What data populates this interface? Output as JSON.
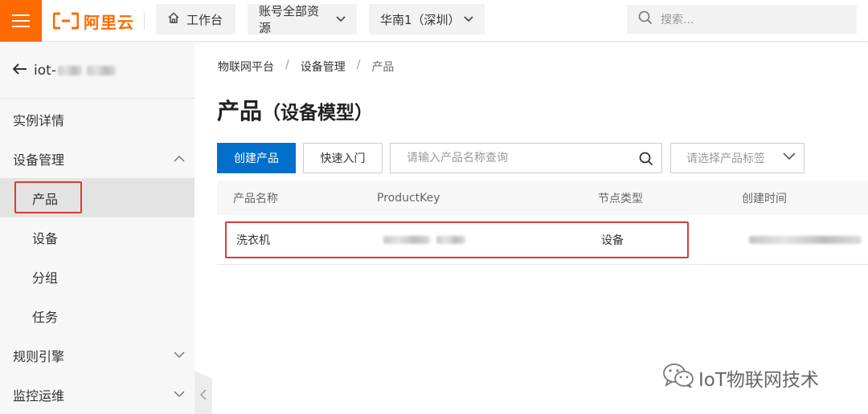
{
  "topbar": {
    "logo_text": "阿里云",
    "home_label": "工作台",
    "account_label": "账号全部资源",
    "region_label": "华南1（深圳）",
    "search_placeholder": "搜索..."
  },
  "sidebar": {
    "back_label": "iot-",
    "items": [
      {
        "label": "实例详情"
      },
      {
        "label": "设备管理"
      },
      {
        "label": "产品"
      },
      {
        "label": "设备"
      },
      {
        "label": "分组"
      },
      {
        "label": "任务"
      },
      {
        "label": "规则引擎"
      },
      {
        "label": "监控运维"
      }
    ]
  },
  "breadcrumb": [
    "物联网平台",
    "/",
    "设备管理",
    "/",
    "产品"
  ],
  "page": {
    "title": "产品",
    "subtitle": "（设备模型）",
    "create_button": "创建产品",
    "quickstart_button": "快速入门",
    "search_placeholder": "请输入产品名称查询",
    "tag_placeholder": "请选择产品标签"
  },
  "table": {
    "headers": [
      "产品名称",
      "ProductKey",
      "节点类型",
      "创建时间"
    ],
    "rows": [
      {
        "name": "洗衣机",
        "node_type": "设备"
      }
    ]
  },
  "watermark": "IoT物联网技术",
  "colors": {
    "brand": "#ff6a00",
    "primary": "#0070cc",
    "highlight": "#d93a3a"
  }
}
